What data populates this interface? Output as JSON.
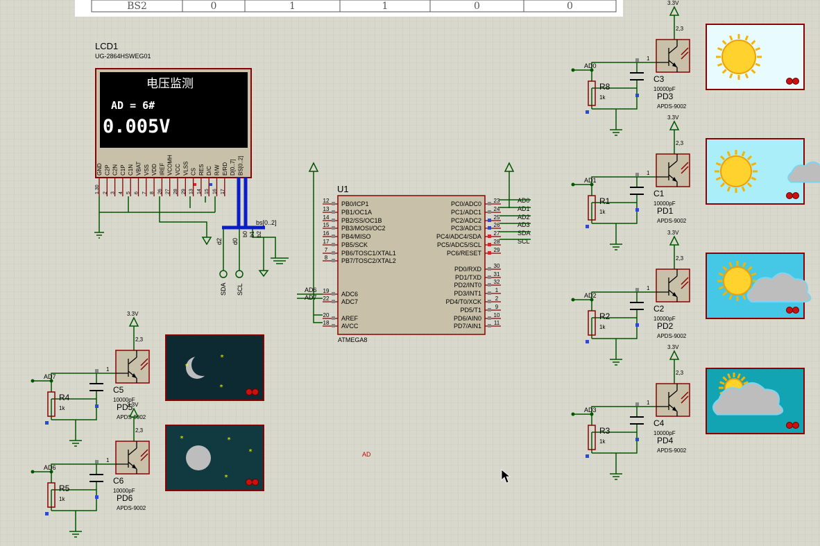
{
  "table_row": {
    "cells": [
      "BS2",
      "0",
      "1",
      "1",
      "0",
      "0"
    ]
  },
  "lcd": {
    "ref": "LCD1",
    "part": "UG-2864HSWEG01",
    "screen_title": "电压监测",
    "screen_line2": "AD = 6#",
    "screen_value": "0.005V",
    "pins": [
      "GND",
      "C2P",
      "C2N",
      "C1P",
      "C1N",
      "VBAT",
      "VSS",
      "VDD",
      "IREF",
      "VCOMH",
      "VCC",
      "VLSS",
      "CS",
      "RES",
      "D/C",
      "R/W",
      "E/RD",
      "D[0..7]",
      "BS[0..2]"
    ],
    "pin_numbers": [
      "1,30",
      "2",
      "3",
      "4",
      "5",
      "6",
      "7",
      "8",
      "26",
      "27",
      "28",
      "29",
      "13",
      "14",
      "15",
      "16",
      "17"
    ],
    "bus_labels": [
      "d2",
      "d0",
      "b0",
      "b1",
      "b2",
      "bs[0..2]"
    ],
    "terminals": [
      "SDA",
      "SCL"
    ]
  },
  "mcu": {
    "ref": "U1",
    "part": "ATMEGA8",
    "left_pins": [
      {
        "num": "12",
        "name": "PB0/ICP1"
      },
      {
        "num": "13",
        "name": "PB1/OC1A"
      },
      {
        "num": "14",
        "name": "PB2/SS/OC1B"
      },
      {
        "num": "15",
        "name": "PB3/MOSI/OC2"
      },
      {
        "num": "16",
        "name": "PB4/MISO"
      },
      {
        "num": "17",
        "name": "PB5/SCK"
      },
      {
        "num": "7",
        "name": "PB6/TOSC1/XTAL1"
      },
      {
        "num": "8",
        "name": "PB7/TOSC2/XTAL2"
      },
      {
        "num": "19",
        "name": "ADC6"
      },
      {
        "num": "22",
        "name": "ADC7"
      },
      {
        "num": "20",
        "name": "AREF"
      },
      {
        "num": "18",
        "name": "AVCC"
      }
    ],
    "right_pins": [
      {
        "num": "23",
        "name": "PC0/ADC0",
        "net": "AD0"
      },
      {
        "num": "24",
        "name": "PC1/ADC1",
        "net": "AD1"
      },
      {
        "num": "25",
        "name": "PC2/ADC2",
        "net": "AD2"
      },
      {
        "num": "26",
        "name": "PC3/ADC3",
        "net": "AD3"
      },
      {
        "num": "27",
        "name": "PC4/ADC4/SDA",
        "net": "SDA"
      },
      {
        "num": "28",
        "name": "PC5/ADC5/SCL",
        "net": "SCL"
      },
      {
        "num": "29",
        "name": "PC6/RESET",
        "net": ""
      },
      {
        "num": "30",
        "name": "PD0/RXD",
        "net": ""
      },
      {
        "num": "31",
        "name": "PD1/TXD",
        "net": ""
      },
      {
        "num": "32",
        "name": "PD2/INT0",
        "net": ""
      },
      {
        "num": "1",
        "name": "PD3/INT1",
        "net": ""
      },
      {
        "num": "2",
        "name": "PD4/T0/XCK",
        "net": ""
      },
      {
        "num": "9",
        "name": "PD5/T1",
        "net": ""
      },
      {
        "num": "10",
        "name": "PD6/AIN0",
        "net": ""
      },
      {
        "num": "11",
        "name": "PD7/AIN1",
        "net": ""
      }
    ],
    "left_nets": [
      "AD6",
      "AD7"
    ]
  },
  "sensors": [
    {
      "pd": "PD3",
      "r": "R8",
      "c": "C3",
      "net": "AD0",
      "sky": "sunny"
    },
    {
      "pd": "PD1",
      "r": "R1",
      "c": "C1",
      "net": "AD1",
      "sky": "sun-small-cloud"
    },
    {
      "pd": "PD2",
      "r": "R2",
      "c": "C2",
      "net": "AD2",
      "sky": "sun-cloud"
    },
    {
      "pd": "PD4",
      "r": "R3",
      "c": "C4",
      "net": "AD3",
      "sky": "cloudy"
    },
    {
      "pd": "PD5",
      "r": "R4",
      "c": "C5",
      "net": "AD7",
      "sky": "moon-crescent"
    },
    {
      "pd": "PD6",
      "r": "R5",
      "c": "C6",
      "net": "AD6",
      "sky": "moon-full"
    }
  ],
  "common": {
    "supply": "3.3V",
    "pins23": "2,3",
    "pin1": "1",
    "res_val": "1k",
    "cap_val": "10000pF",
    "part": "APDS-9002"
  },
  "stray_label": "AD",
  "colors": {
    "wire": "#005500",
    "part": "#8b0000",
    "body": "#c8c0a8",
    "bus": "#0a1ec8",
    "grid": "#d8d8cc"
  },
  "icons": {
    "sun": "sun-icon",
    "cloud": "cloud-icon",
    "moon": "moon-icon",
    "star": "star-icon",
    "cursor": "mouse-cursor-icon"
  }
}
